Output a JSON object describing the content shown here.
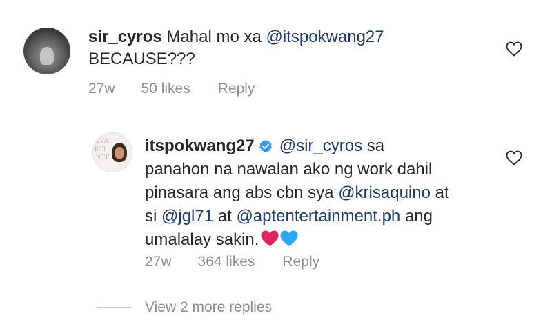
{
  "comments": [
    {
      "username": "sir_cyros",
      "text_before": "Mahal mo xa ",
      "mention": "@itspokwang27",
      "text_after": "BECAUSE???",
      "time": "27w",
      "likes": "50 likes",
      "reply": "Reply",
      "avatar_icon": "profile-photo"
    }
  ],
  "reply": {
    "username": "itspokwang27",
    "verified": true,
    "verified_color": "#3897f0",
    "mention1": "@sir_cyros",
    "text1": " sa",
    "line2": "panahon na nawalan ako ng work dahil",
    "line3_prefix": "pinasara ang abs cbn sya ",
    "mention2": "@krisaquino",
    "line3_suffix": " at",
    "line4_prefix": "si ",
    "mention3": "@jgl71",
    "line4_mid": " at ",
    "mention4": "@aptentertainment.ph",
    "line4_suffix": " ang",
    "line5": "umalalay sakin.",
    "time": "27w",
    "likes": "364 likes",
    "reply_label": "Reply",
    "avatar_text_1": "GVA",
    "avatar_text_2": "RTI",
    "avatar_text_3": "NTE",
    "emoji_colors": [
      "#e0245e",
      "#2ea7f2"
    ]
  },
  "view_more": "View 2 more replies",
  "colors": {
    "text": "#262626",
    "meta": "#8e8e8e",
    "mention": "#1d3a6b"
  }
}
